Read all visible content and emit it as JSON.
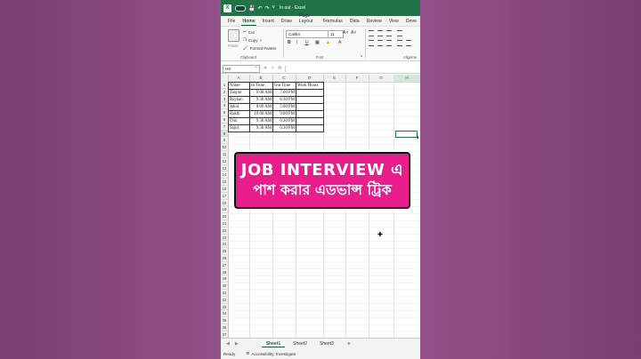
{
  "window": {
    "app_logo": "X",
    "doc_title": "In out  -  Excel",
    "qa_icons": [
      "save-icon",
      "undo-icon",
      "redo-icon",
      "dropdown-icon"
    ]
  },
  "ribbon_tabs": [
    "File",
    "Home",
    "Insert",
    "Draw",
    "Page Layout",
    "Formulas",
    "Data",
    "Review",
    "View",
    "Deve"
  ],
  "active_tab": "Home",
  "clipboard": {
    "paste_label": "Paste",
    "cut_label": "Cut",
    "copy_label": "Copy",
    "format_painter_label": "Format Painter",
    "group_label": "Clipboard"
  },
  "font_group": {
    "font_name": "Calibri",
    "font_size": "11",
    "grow": "A˄",
    "shrink": "A˅",
    "bold": "B",
    "italic": "I",
    "underline": "U",
    "group_label": "Font"
  },
  "alignment_group": {
    "group_label": "Alignme"
  },
  "formula_bar": {
    "name_box": "H8",
    "cancel": "✕",
    "enter": "✓",
    "fx": "fx"
  },
  "columns": [
    "A",
    "B",
    "C",
    "D",
    "E",
    "F",
    "G",
    "H"
  ],
  "rows": [
    "1",
    "2",
    "3",
    "4",
    "5",
    "6",
    "7",
    "8",
    "9",
    "10",
    "11",
    "12",
    "13",
    "14",
    "15",
    "16",
    "17",
    "18",
    "19",
    "20",
    "21",
    "22",
    "23",
    "24",
    "25",
    "26",
    "27",
    "28",
    "29",
    "30",
    "31",
    "32",
    "33",
    "34",
    "35",
    "36",
    "37"
  ],
  "table": {
    "headers": [
      "Name",
      "In Time",
      "Out Time",
      "Work Hours"
    ],
    "rows": [
      [
        "Tanjim",
        "9:00 AM",
        "7:00 PM",
        ""
      ],
      [
        "Rayhan",
        "9:30 AM",
        "6:30 PM",
        ""
      ],
      [
        "Jahid",
        "8:00 AM",
        "5:00 PM",
        ""
      ],
      [
        "Rakib",
        "10:00 AM",
        "9:00 PM",
        ""
      ],
      [
        "Omi",
        "9:30 AM",
        "6:30 PM",
        ""
      ],
      [
        "Sajid",
        "9:30 AM",
        "6:30 PM",
        ""
      ]
    ]
  },
  "sheet_tabs": [
    "Sheet1",
    "Sheet2",
    "Sheet3"
  ],
  "active_sheet": "Sheet1",
  "sheet_add": "+",
  "status": {
    "ready": "Ready",
    "accessibility": "Accessibility: Investigate"
  },
  "banner": {
    "line1": "JOB INTERVIEW এ",
    "line2": "পাশ করার এডভান্স ট্রিক",
    "color": "#ea1d8c"
  },
  "colors": {
    "excel_green": "#217346",
    "background": "#8f4a80"
  }
}
